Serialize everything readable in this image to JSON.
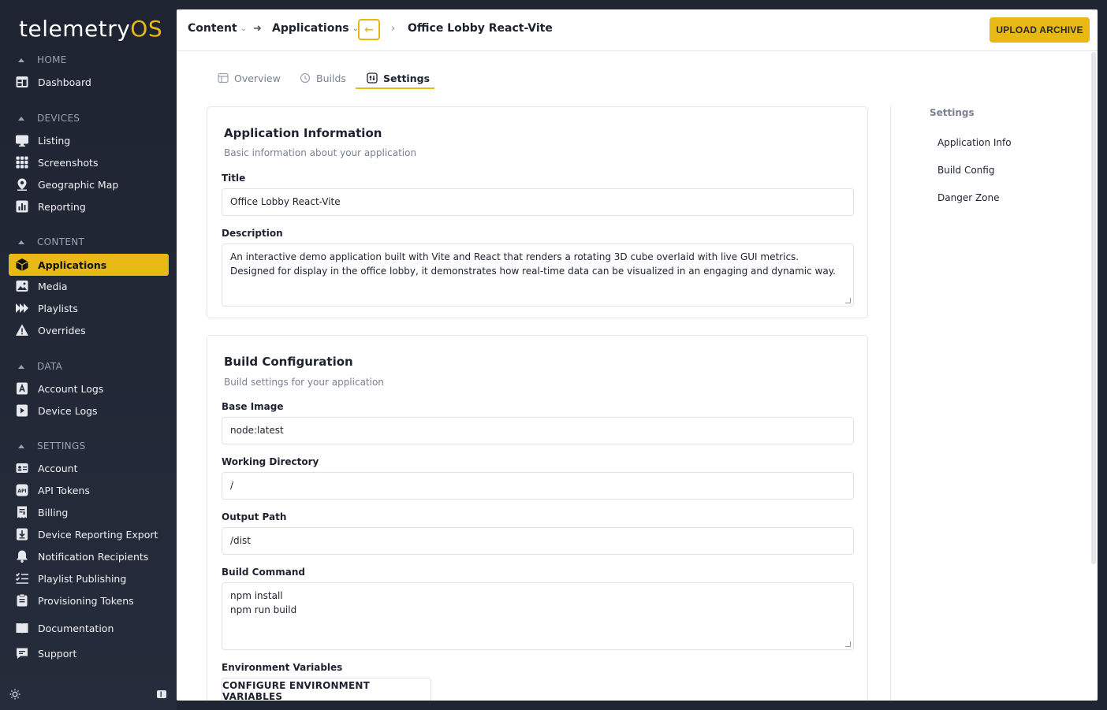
{
  "brand": {
    "name_main": "telemetry",
    "name_accent": "OS",
    "accent_color": "#e8b814"
  },
  "sidebar": {
    "sections": {
      "home": "HOME",
      "devices": "DEVICES",
      "content": "CONTENT",
      "data": "DATA",
      "settings": "SETTINGS"
    },
    "items": {
      "dashboard": "Dashboard",
      "listing": "Listing",
      "screenshots": "Screenshots",
      "geographic_map": "Geographic Map",
      "reporting": "Reporting",
      "applications": "Applications",
      "media": "Media",
      "playlists": "Playlists",
      "overrides": "Overrides",
      "account_logs": "Account Logs",
      "device_logs": "Device Logs",
      "account": "Account",
      "api_tokens": "API Tokens",
      "billing": "Billing",
      "device_reporting_export": "Device Reporting Export",
      "notification_recipients": "Notification Recipients",
      "playlist_publishing": "Playlist Publishing",
      "provisioning_tokens": "Provisioning Tokens",
      "documentation": "Documentation",
      "support": "Support"
    },
    "active_item": "Applications"
  },
  "topbar": {
    "crumb_content": "Content",
    "crumb_applications": "Applications",
    "crumb_current": "Office Lobby React-Vite",
    "back_symbol": "←",
    "upload_label": "UPLOAD ARCHIVE"
  },
  "tabs": {
    "overview": "Overview",
    "builds": "Builds",
    "settings": "Settings",
    "active": "Settings"
  },
  "app_info": {
    "title": "Application Information",
    "subtitle": "Basic information about your application",
    "title_label": "Title",
    "title_value": "Office Lobby React-Vite",
    "description_label": "Description",
    "description_value": "An interactive demo application built with Vite and React that renders a rotating 3D cube overlaid with live GUI metrics. Designed for display in the office lobby, it demonstrates how real-time data can be visualized in an engaging and dynamic way."
  },
  "build_config": {
    "title": "Build Configuration",
    "subtitle": "Build settings for your application",
    "base_image_label": "Base Image",
    "base_image_value": "node:latest",
    "working_dir_label": "Working Directory",
    "working_dir_value": "/",
    "output_path_label": "Output Path",
    "output_path_value": "/dist",
    "build_command_label": "Build Command",
    "build_command_value": "npm install\nnpm run build",
    "env_vars_label": "Environment Variables",
    "env_vars_button": "CONFIGURE ENVIRONMENT VARIABLES"
  },
  "toc": {
    "title": "Settings",
    "items": [
      "Application Info",
      "Build Config",
      "Danger Zone"
    ]
  }
}
